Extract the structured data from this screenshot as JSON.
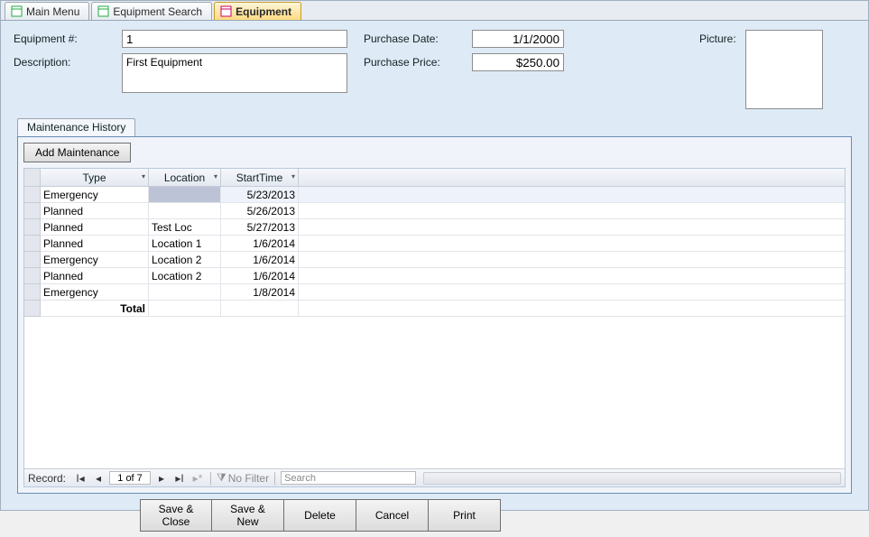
{
  "tabs": [
    {
      "label": "Main Menu"
    },
    {
      "label": "Equipment Search"
    },
    {
      "label": "Equipment"
    }
  ],
  "active_tab_index": 2,
  "form": {
    "equipment_no_label": "Equipment #:",
    "equipment_no_value": "1",
    "description_label": "Description:",
    "description_value": "First Equipment",
    "purchase_date_label": "Purchase Date:",
    "purchase_date_value": "1/1/2000",
    "purchase_price_label": "Purchase Price:",
    "purchase_price_value": "$250.00",
    "picture_label": "Picture:"
  },
  "subform": {
    "tab_label": "Maintenance History",
    "add_button_label": "Add Maintenance",
    "columns": {
      "type": "Type",
      "location": "Location",
      "starttime": "StartTime"
    },
    "rows": [
      {
        "type": "Emergency",
        "location": "",
        "starttime": "5/23/2013"
      },
      {
        "type": "Planned",
        "location": "",
        "starttime": "5/26/2013"
      },
      {
        "type": "Planned",
        "location": "Test Loc",
        "starttime": "5/27/2013"
      },
      {
        "type": "Planned",
        "location": "Location 1",
        "starttime": "1/6/2014"
      },
      {
        "type": "Emergency",
        "location": "Location 2",
        "starttime": "1/6/2014"
      },
      {
        "type": "Planned",
        "location": "Location 2",
        "starttime": "1/6/2014"
      },
      {
        "type": "Emergency",
        "location": "",
        "starttime": "1/8/2014"
      }
    ],
    "total_label": "Total"
  },
  "nav": {
    "record_label": "Record:",
    "position": "1 of 7",
    "no_filter_label": "No Filter",
    "search_placeholder": "Search"
  },
  "buttons": {
    "save_close": "Save & Close",
    "save_new": "Save & New",
    "delete": "Delete",
    "cancel": "Cancel",
    "print": "Print"
  }
}
